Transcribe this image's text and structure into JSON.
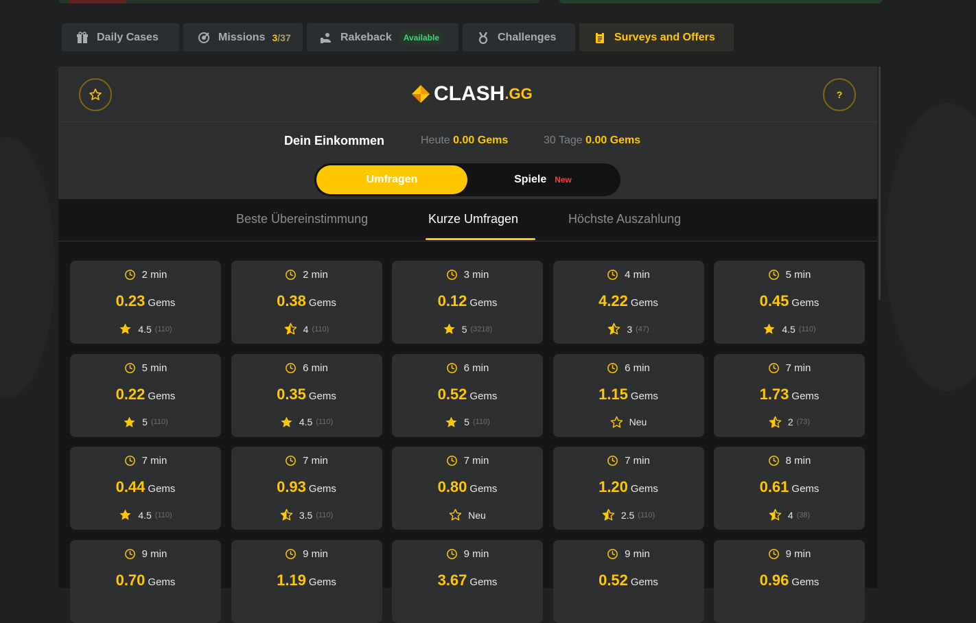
{
  "colors": {
    "accent": "#ffc700",
    "available": "#3fd673",
    "new": "#ff3b3b"
  },
  "tabs": [
    {
      "label": "Daily Cases",
      "icon": "gift-icon"
    },
    {
      "label": "Missions",
      "icon": "target-icon",
      "count": "3",
      "total": "/37"
    },
    {
      "label": "Rakeback",
      "icon": "coins-hand-icon",
      "badge": "Available"
    },
    {
      "label": "Challenges",
      "icon": "medal-icon"
    },
    {
      "label": "Surveys and Offers",
      "icon": "clipboard-icon",
      "active": true
    }
  ],
  "header": {
    "logo_text": "CLASH",
    "logo_suffix": ".GG",
    "help": "?"
  },
  "income": {
    "title": "Dein Einkommen",
    "today_label": "Heute",
    "today_value": "0.00 Gems",
    "month_label": "30 Tage",
    "month_value": "0.00 Gems"
  },
  "toggle": {
    "on": "Umfragen",
    "off": "Spiele",
    "off_badge": "New"
  },
  "subtabs": [
    "Beste Übereinstimmung",
    "Kurze Umfragen",
    "Höchste Auszahlung"
  ],
  "active_subtab": "Kurze Umfragen",
  "gem_unit": "Gems",
  "cards": [
    {
      "time": "2 min",
      "gems": "0.23",
      "rating": "4.5",
      "count": "(110)",
      "stars": "full"
    },
    {
      "time": "2 min",
      "gems": "0.38",
      "rating": "4",
      "count": "(110)",
      "stars": "half"
    },
    {
      "time": "3 min",
      "gems": "0.12",
      "rating": "5",
      "count": "(3218)",
      "stars": "full"
    },
    {
      "time": "4 min",
      "gems": "4.22",
      "rating": "3",
      "count": "(47)",
      "stars": "half"
    },
    {
      "time": "5 min",
      "gems": "0.45",
      "rating": "4.5",
      "count": "(110)",
      "stars": "full"
    },
    {
      "time": "5 min",
      "gems": "0.22",
      "rating": "5",
      "count": "(110)",
      "stars": "full"
    },
    {
      "time": "6 min",
      "gems": "0.35",
      "rating": "4.5",
      "count": "(110)",
      "stars": "full"
    },
    {
      "time": "6 min",
      "gems": "0.52",
      "rating": "5",
      "count": "(110)",
      "stars": "full"
    },
    {
      "time": "6 min",
      "gems": "1.15",
      "rating": "Neu",
      "count": "",
      "stars": "empty"
    },
    {
      "time": "7 min",
      "gems": "1.73",
      "rating": "2",
      "count": "(73)",
      "stars": "half"
    },
    {
      "time": "7 min",
      "gems": "0.44",
      "rating": "4.5",
      "count": "(110)",
      "stars": "full"
    },
    {
      "time": "7 min",
      "gems": "0.93",
      "rating": "3.5",
      "count": "(110)",
      "stars": "half"
    },
    {
      "time": "7 min",
      "gems": "0.80",
      "rating": "Neu",
      "count": "",
      "stars": "empty"
    },
    {
      "time": "7 min",
      "gems": "1.20",
      "rating": "2.5",
      "count": "(110)",
      "stars": "half"
    },
    {
      "time": "8 min",
      "gems": "0.61",
      "rating": "4",
      "count": "(38)",
      "stars": "half"
    },
    {
      "time": "9 min",
      "gems": "0.70",
      "rating": "",
      "count": "",
      "stars": "full"
    },
    {
      "time": "9 min",
      "gems": "1.19",
      "rating": "",
      "count": "",
      "stars": "full"
    },
    {
      "time": "9 min",
      "gems": "3.67",
      "rating": "",
      "count": "",
      "stars": "full"
    },
    {
      "time": "9 min",
      "gems": "0.52",
      "rating": "",
      "count": "",
      "stars": "full"
    },
    {
      "time": "9 min",
      "gems": "0.96",
      "rating": "",
      "count": "",
      "stars": "full"
    }
  ]
}
